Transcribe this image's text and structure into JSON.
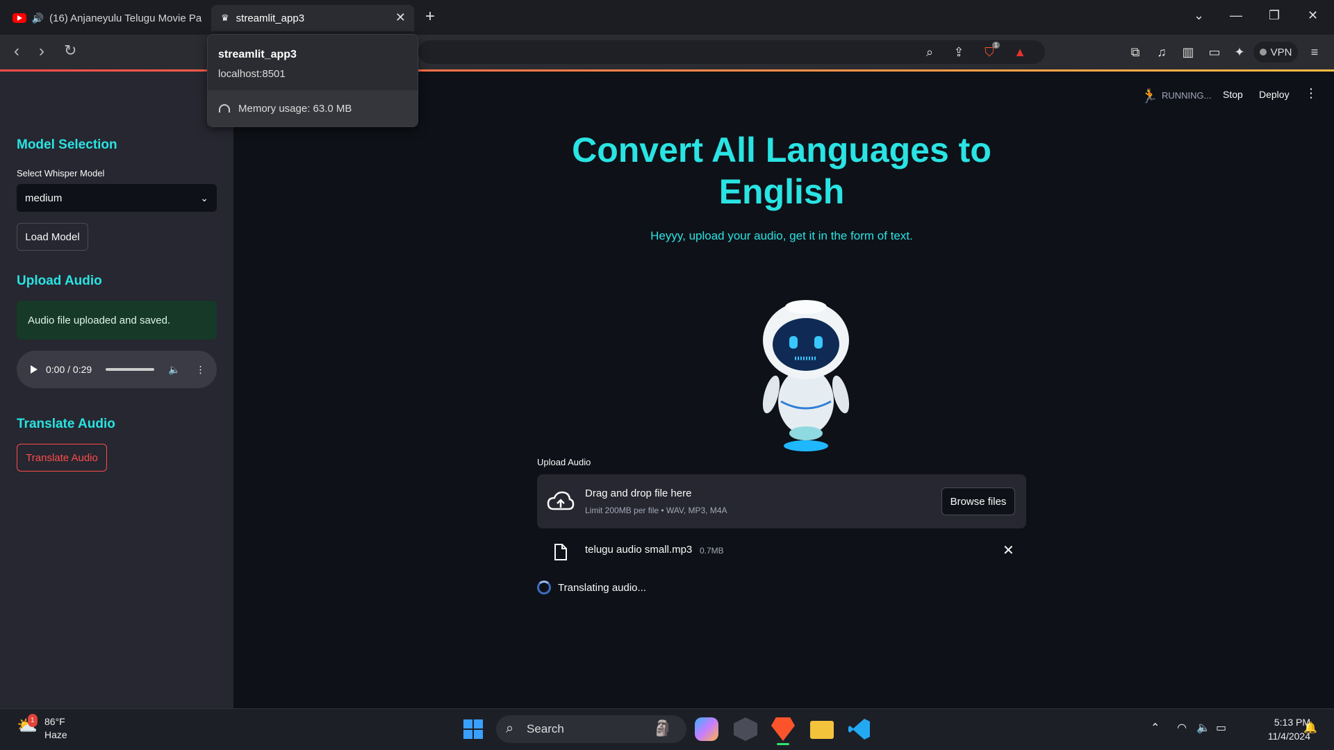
{
  "browser": {
    "tabs": [
      {
        "label": "(16) Anjaneyulu Telugu Movie Pa"
      },
      {
        "label": "streamlit_app3"
      }
    ],
    "vpn_label": "VPN",
    "shields_badge": "1"
  },
  "tab_popup": {
    "title": "streamlit_app3",
    "host": "localhost:8501",
    "memory": "Memory usage: 63.0 MB"
  },
  "header": {
    "status": "RUNNING...",
    "stop_label": "Stop",
    "deploy_label": "Deploy"
  },
  "sidebar": {
    "model_heading": "Model Selection",
    "select_label": "Select Whisper Model",
    "select_value": "medium",
    "load_button": "Load Model",
    "upload_heading": "Upload Audio",
    "success_message": "Audio file uploaded and saved.",
    "audio_time": "0:00 / 0:29",
    "translate_heading": "Translate Audio",
    "translate_button": "Translate Audio"
  },
  "main": {
    "title": "Convert All Languages to English",
    "subtitle": "Heyyy, upload your audio, get it in the form of text.",
    "upload_label": "Upload Audio",
    "dropzone_text": "Drag and drop file here",
    "dropzone_limit": "Limit 200MB per file • WAV, MP3, M4A",
    "browse_button": "Browse files",
    "file_name": "telugu audio small.mp3",
    "file_size": "0.7MB",
    "spinner_text": "Translating audio..."
  },
  "taskbar": {
    "weather_temp": "86°F",
    "weather_desc": "Haze",
    "weather_badge": "1",
    "search_placeholder": "Search",
    "time": "5:13 PM",
    "date": "11/4/2024"
  },
  "colors": {
    "accent_cyan": "#2ae3e3",
    "primary_red": "#ff4b4b",
    "success_bg": "#173928",
    "sidebar_bg": "#262730",
    "app_bg": "#0e1117"
  }
}
